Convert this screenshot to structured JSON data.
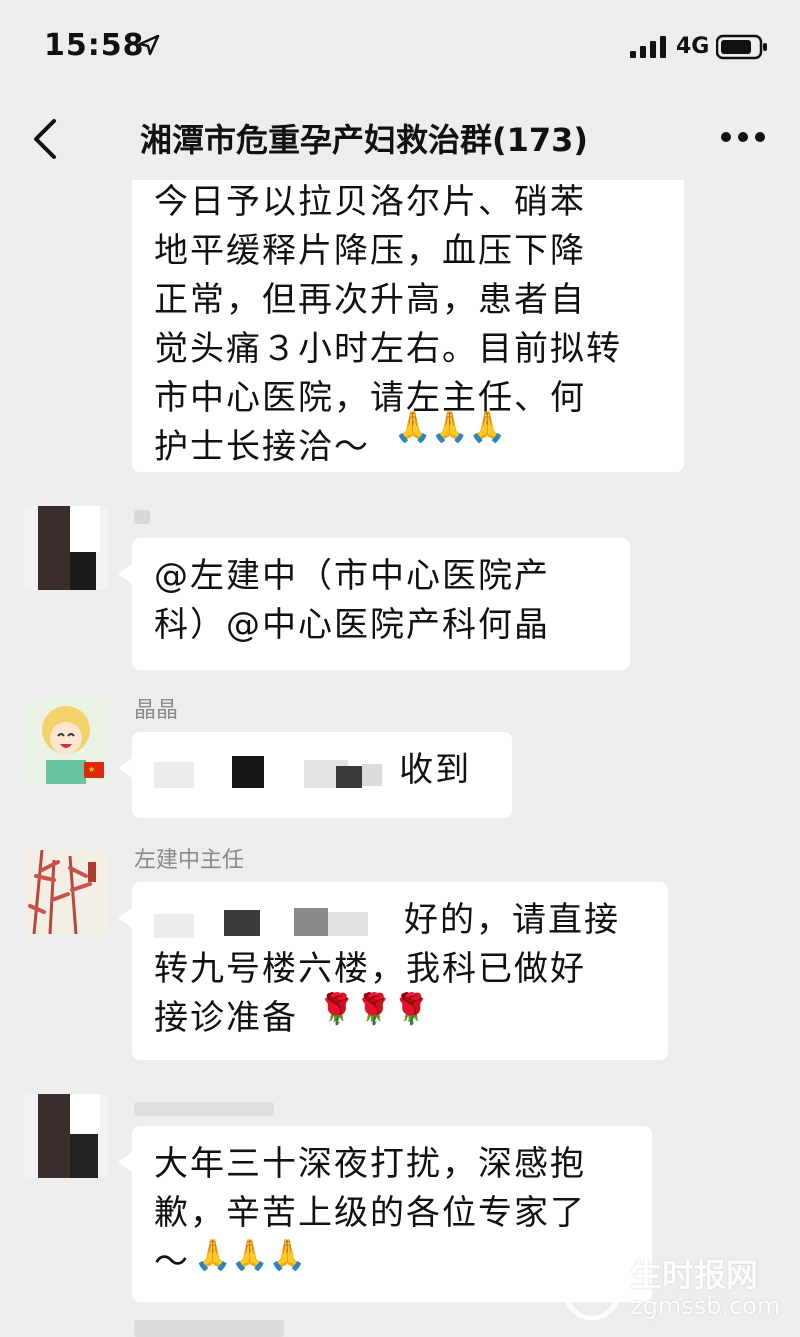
{
  "status_bar": {
    "time": "15:58",
    "network": "4G"
  },
  "nav": {
    "title": "湘潭市危重孕产妇救治群(173)"
  },
  "messages": [
    {
      "sender": "",
      "text": "今日予以拉贝洛尔片、硝苯\n地平缓释片降压，血压下降\n正常，但再次升高，患者自\n觉头痛３小时左右。目前拟转\n市中心医院，请左主任、何\n护士长接洽～",
      "emoji": "🙏🙏🙏"
    },
    {
      "sender": "",
      "text": "@左建中（市中心医院产\n科）@中心医院产科何晶"
    },
    {
      "sender": "晶晶",
      "text": "收到"
    },
    {
      "sender": "左建中主任",
      "text": "好的，请直接\n转九号楼六楼，我科已做好\n接诊准备",
      "emoji": "🌹🌹🌹"
    },
    {
      "sender": "",
      "text": "大年三十深夜打扰，深感抱\n歉，辛苦上级的各位专家了\n～",
      "emoji": "🙏🙏🙏"
    }
  ],
  "watermark": {
    "text": "生时报网",
    "sub": "zgmssb.com"
  }
}
